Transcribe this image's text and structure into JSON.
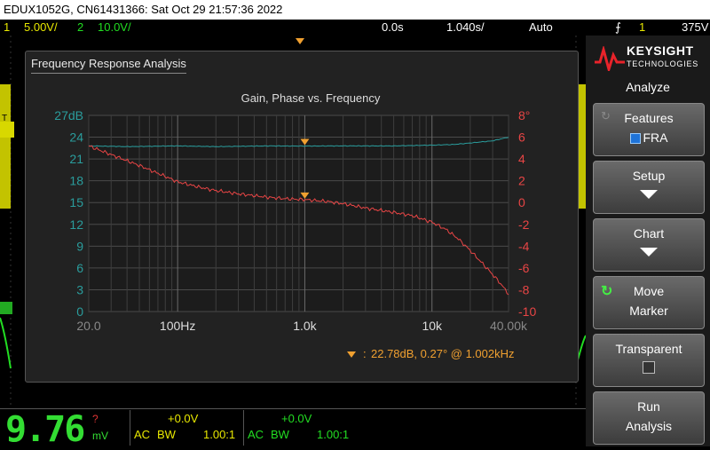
{
  "titlebar": {
    "text": "EDUX1052G, CN61431366: Sat Oct 29 21:57:36 2022"
  },
  "status": {
    "ch1_num": "1",
    "ch1_scale": "5.00V/",
    "ch2_num": "2",
    "ch2_scale": "10.0V/",
    "time_offset": "0.0s",
    "timebase": "1.040s/",
    "trigger_mode": "Auto",
    "trigger_num": "1",
    "trigger_level": "375V"
  },
  "fra": {
    "panel_title": "Frequency Response Analysis",
    "marker_readout": "22.78dB, 0.27° @ 1.002kHz",
    "marker_colon": ":"
  },
  "chart_data": {
    "type": "line",
    "title": "Gain, Phase vs. Frequency",
    "x_scale": "log",
    "x_range": [
      20,
      40000
    ],
    "x_tick_labels": [
      "20.0",
      "100Hz",
      "1.0k",
      "10k",
      "40.00k"
    ],
    "x_ticks": [
      20,
      100,
      1000,
      10000,
      40000
    ],
    "y_left_range": [
      0,
      27
    ],
    "y_left_tick_labels": [
      "27dB",
      "24",
      "21",
      "18",
      "15",
      "12",
      "9",
      "6",
      "3",
      "0"
    ],
    "y_right_range": [
      -10,
      8
    ],
    "y_right_tick_labels": [
      "8°",
      "6",
      "4",
      "2",
      "0",
      "-2",
      "-4",
      "-6",
      "-8",
      "-10"
    ],
    "grid": true,
    "series": [
      {
        "key": "gain",
        "axis": "left",
        "color": "#2a9d9d",
        "x": [
          20,
          40,
          100,
          200,
          500,
          1000,
          2000,
          5000,
          10000,
          15000,
          20000,
          30000,
          40000
        ],
        "y": [
          22.8,
          22.7,
          22.8,
          22.7,
          22.8,
          22.78,
          22.8,
          22.8,
          22.9,
          23.0,
          23.2,
          23.5,
          24.0
        ]
      },
      {
        "key": "phase",
        "axis": "right",
        "color": "#e84545",
        "x": [
          20,
          30,
          50,
          80,
          100,
          150,
          200,
          300,
          500,
          700,
          1000,
          1500,
          2000,
          3000,
          5000,
          7000,
          10000,
          13000,
          16000,
          20000,
          25000,
          30000,
          35000,
          40000
        ],
        "y": [
          5.2,
          4.4,
          3.4,
          2.4,
          1.9,
          1.4,
          1.1,
          0.8,
          0.5,
          0.35,
          0.27,
          0.1,
          -0.1,
          -0.5,
          -0.9,
          -1.2,
          -1.8,
          -2.5,
          -3.3,
          -4.4,
          -5.6,
          -6.6,
          -7.5,
          -8.4
        ]
      }
    ],
    "markers": [
      {
        "x": 1000,
        "axis": "left",
        "y": 22.78
      },
      {
        "x": 1000,
        "axis": "right",
        "y": 0.27
      }
    ]
  },
  "side": {
    "brand": "KEYSIGHT",
    "brand_sub": "TECHNOLOGIES",
    "menu_title": "Analyze",
    "buttons": [
      {
        "line1": "Features",
        "line2": "FRA"
      },
      {
        "line1": "Setup",
        "line2": ""
      },
      {
        "line1": "Chart",
        "line2": ""
      },
      {
        "line1": "Move",
        "line2": "Marker"
      },
      {
        "line1": "Transparent",
        "line2": ""
      },
      {
        "line1": "Run",
        "line2": "Analysis"
      }
    ]
  },
  "bottom": {
    "reading": "9.76",
    "reading_unit": "mV",
    "reading_flag": "?",
    "ch1_offset": "+0.0V",
    "ch1_coupling": "AC",
    "ch1_bw": "BW",
    "ch1_probe": "1.00:1",
    "ch2_offset": "+0.0V",
    "ch2_coupling": "AC",
    "ch2_bw": "BW",
    "ch2_probe": "1.00:1"
  }
}
